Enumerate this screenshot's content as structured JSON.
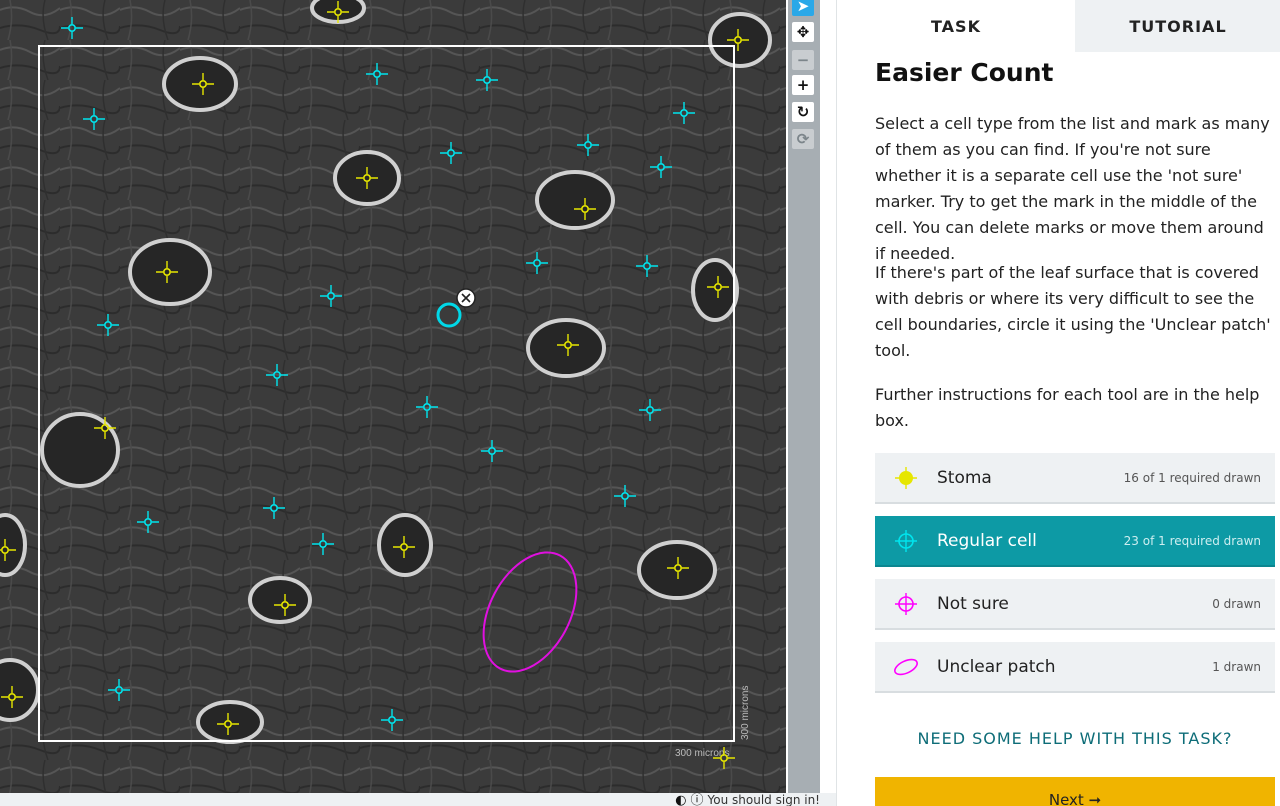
{
  "viewer": {
    "scale_label_horizontal": "300 microns",
    "scale_label_vertical": "300 microns"
  },
  "toolbar": {
    "tools": [
      {
        "icon": "pointer-icon",
        "glyph": "➤"
      },
      {
        "icon": "move-icon",
        "glyph": "✥"
      },
      {
        "icon": "zoom-out-icon",
        "glyph": "−"
      },
      {
        "icon": "zoom-in-icon",
        "glyph": "+"
      },
      {
        "icon": "rotate-icon",
        "glyph": "↻"
      },
      {
        "icon": "reset-icon",
        "glyph": "⟳"
      }
    ]
  },
  "footer": {
    "icons": [
      "contrast-icon",
      "info-icon"
    ],
    "signin_text": "You should sign in!"
  },
  "tabs": {
    "task": "TASK",
    "tutorial": "TUTORIAL"
  },
  "task": {
    "title": "Easier Count",
    "paragraphs": [
      "Select a cell type from the list and mark as many of them as you can find. If you're not sure whether it is a separate cell use the 'not sure' marker. Try to get the mark in the middle of the cell. You can delete marks or move them around if needed.",
      "If there's part of the leaf surface that is covered with debris or where its very difficult to see the cell boundaries, circle it using the 'Unclear patch' tool.",
      "Further instructions for each tool are in the help box."
    ],
    "tools": [
      {
        "label": "Stoma",
        "count": "16 of 1 required drawn",
        "color": "#e6e600"
      },
      {
        "label": "Regular cell",
        "count": "23 of 1 required drawn",
        "color": "#00e5ee"
      },
      {
        "label": "Not sure",
        "count": "0 drawn",
        "color": "#ff00ff"
      },
      {
        "label": "Unclear patch",
        "count": "1 drawn",
        "color": "#ff00ff"
      }
    ],
    "help_link": "NEED SOME HELP WITH THIS TASK?",
    "next_label": "Next ➞"
  },
  "colors": {
    "accent": "#0d9aa5",
    "next": "#f0b400",
    "stoma": "#e6e600",
    "regular": "#00e5ee",
    "unclear": "#e010e0"
  }
}
